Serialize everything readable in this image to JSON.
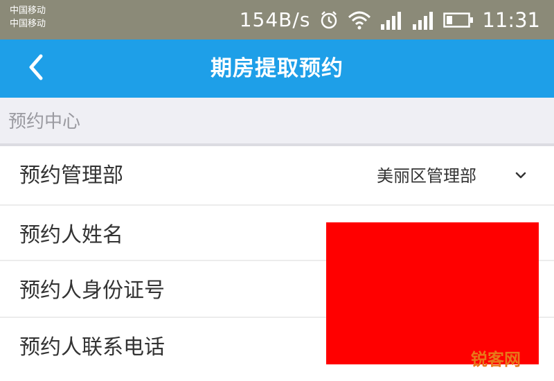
{
  "status_bar": {
    "carrier_1": "中国移动",
    "carrier_2": "中国移动",
    "net_speed": "154B/s",
    "time": "11:31"
  },
  "nav": {
    "title": "期房提取预约"
  },
  "section": {
    "label": "预约中心"
  },
  "form": {
    "rows": [
      {
        "label": "预约管理部",
        "value": "美丽区管理部"
      },
      {
        "label": "预约人姓名"
      },
      {
        "label": "预约人身份证号"
      },
      {
        "label": "预约人联系电话"
      }
    ]
  },
  "watermark": "锐客网",
  "colors": {
    "nav_background": "#1e9fe8",
    "status_background": "#8b8a78",
    "redaction": "#ff0000"
  },
  "icons": [
    "alarm-icon",
    "wifi-icon",
    "signal-icon",
    "battery-icon",
    "back-arrow-icon",
    "chevron-down-icon"
  ]
}
